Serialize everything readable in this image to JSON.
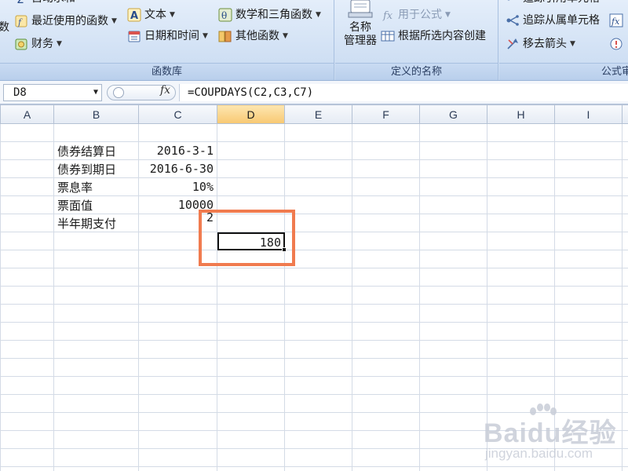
{
  "ribbon": {
    "function_library": {
      "label": "函数库",
      "cut_item_top": "自动求和",
      "cut_item_left": "数",
      "recent": "最近使用的函数",
      "financial": "财务",
      "text": "文本",
      "datetime": "日期和时间",
      "math": "数学和三角函数",
      "other": "其他函数"
    },
    "defined_names": {
      "label": "定义的名称",
      "name_manager_line1": "名称",
      "name_manager_line2": "管理器",
      "use_in_formula": "用于公式",
      "create_from_selection": "根据所选内容创建"
    },
    "formula_auditing": {
      "label": "公式审核",
      "trace_precedents": "追踪引用单元格",
      "trace_dependents": "追踪从属单元格",
      "remove_arrows": "移去箭头"
    }
  },
  "formula_bar": {
    "name_box": "D8",
    "fx": "fx",
    "formula": "=COUPDAYS(C2,C3,C7)"
  },
  "sheet": {
    "columns": [
      "A",
      "B",
      "C",
      "D",
      "E",
      "F",
      "G",
      "H",
      "I"
    ],
    "active_column": "D",
    "rows": {
      "r2": {
        "label": "债券结算日",
        "value": "2016-3-1"
      },
      "r3": {
        "label": "债券到期日",
        "value": "2016-6-30"
      },
      "r4": {
        "label": "票息率",
        "value": "10%"
      },
      "r5": {
        "label": "票面值",
        "value": "10000"
      },
      "r6": {
        "label": "半年期支付",
        "value": "2"
      }
    },
    "active_cell": {
      "ref": "D8",
      "value": "180"
    }
  },
  "watermark": {
    "main": "Baidu经验",
    "sub": "jingyan.baidu.com"
  },
  "colors": {
    "highlight": "#f07b4f",
    "active_column_header": "#f8c872",
    "ribbon_bg": "#d3e2f5"
  }
}
